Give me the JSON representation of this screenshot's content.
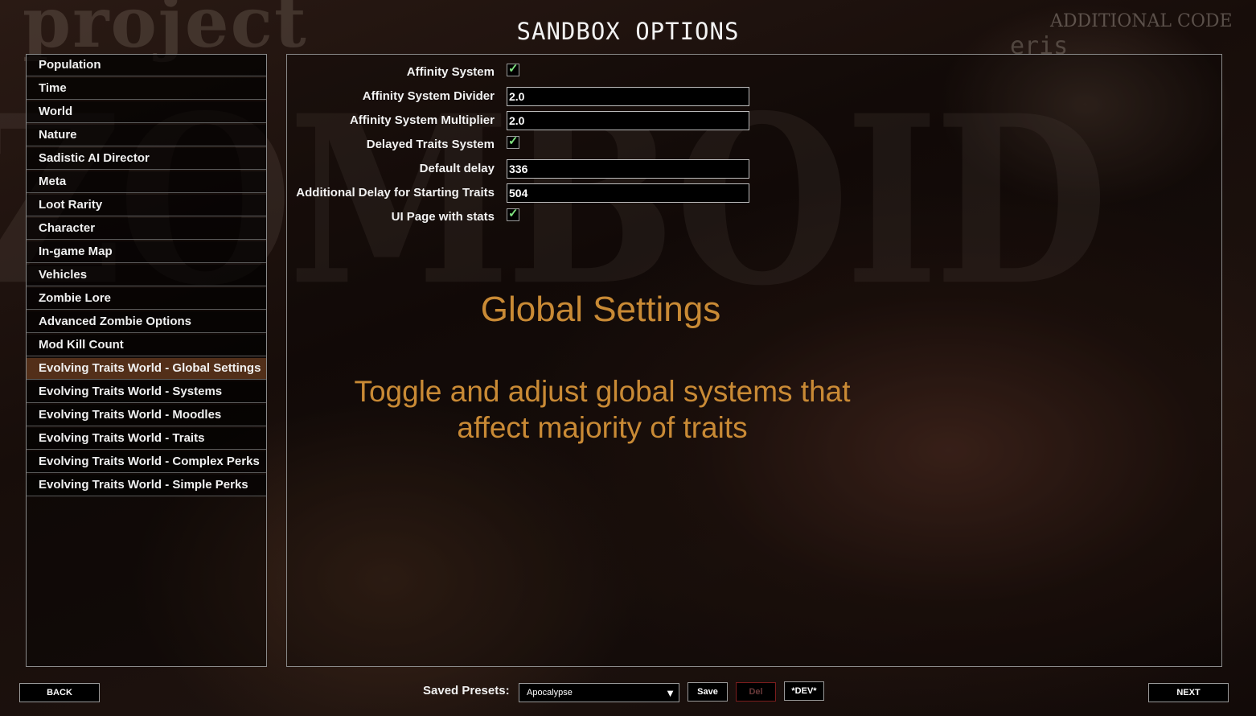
{
  "background": {
    "logo_top": "project",
    "logo_big": "ZOMBOID"
  },
  "header": {
    "title": "SANDBOX OPTIONS",
    "additional_code": "ADDITIONAL CODE",
    "additional_code_sub": "eris"
  },
  "sidebar": {
    "items": [
      {
        "label": "Population"
      },
      {
        "label": "Time"
      },
      {
        "label": "World"
      },
      {
        "label": "Nature"
      },
      {
        "label": "Sadistic AI Director"
      },
      {
        "label": "Meta"
      },
      {
        "label": "Loot Rarity"
      },
      {
        "label": "Character"
      },
      {
        "label": "In-game Map"
      },
      {
        "label": "Vehicles"
      },
      {
        "label": "Zombie Lore"
      },
      {
        "label": "Advanced Zombie Options"
      },
      {
        "label": "Mod Kill Count"
      },
      {
        "label": "Evolving Traits World - Global Settings",
        "selected": true
      },
      {
        "label": "Evolving Traits World - Systems"
      },
      {
        "label": "Evolving Traits World - Moodles"
      },
      {
        "label": "Evolving Traits World - Traits"
      },
      {
        "label": "Evolving Traits World - Complex Perks"
      },
      {
        "label": "Evolving Traits World - Simple Perks"
      }
    ]
  },
  "options": [
    {
      "label": "Affinity System",
      "type": "checkbox",
      "checked": true
    },
    {
      "label": "Affinity System Divider",
      "type": "text",
      "value": "2.0"
    },
    {
      "label": "Affinity System Multiplier",
      "type": "text",
      "value": "2.0"
    },
    {
      "label": "Delayed Traits System",
      "type": "checkbox",
      "checked": true
    },
    {
      "label": "Default delay",
      "type": "text",
      "value": "336"
    },
    {
      "label": "Additional Delay for Starting Traits",
      "type": "text",
      "value": "504"
    },
    {
      "label": "UI Page with stats",
      "type": "checkbox",
      "checked": true
    }
  ],
  "info": {
    "title": "Global Settings",
    "description_line1": "Toggle and adjust global systems that",
    "description_line2": "affect majority of traits"
  },
  "footer": {
    "back_label": "BACK",
    "next_label": "NEXT",
    "presets_label": "Saved Presets:",
    "preset_selected": "Apocalypse",
    "dropdown_arrow": "▼",
    "save_label": "Save",
    "del_label": "Del",
    "dev_label": "*DEV*"
  },
  "colors": {
    "accent": "#c98a35",
    "selected_item": "#693c20",
    "check": "#7ee07e",
    "disabled_border": "#7a1d1d"
  },
  "icons": {
    "checkbox_mark": "✓"
  }
}
